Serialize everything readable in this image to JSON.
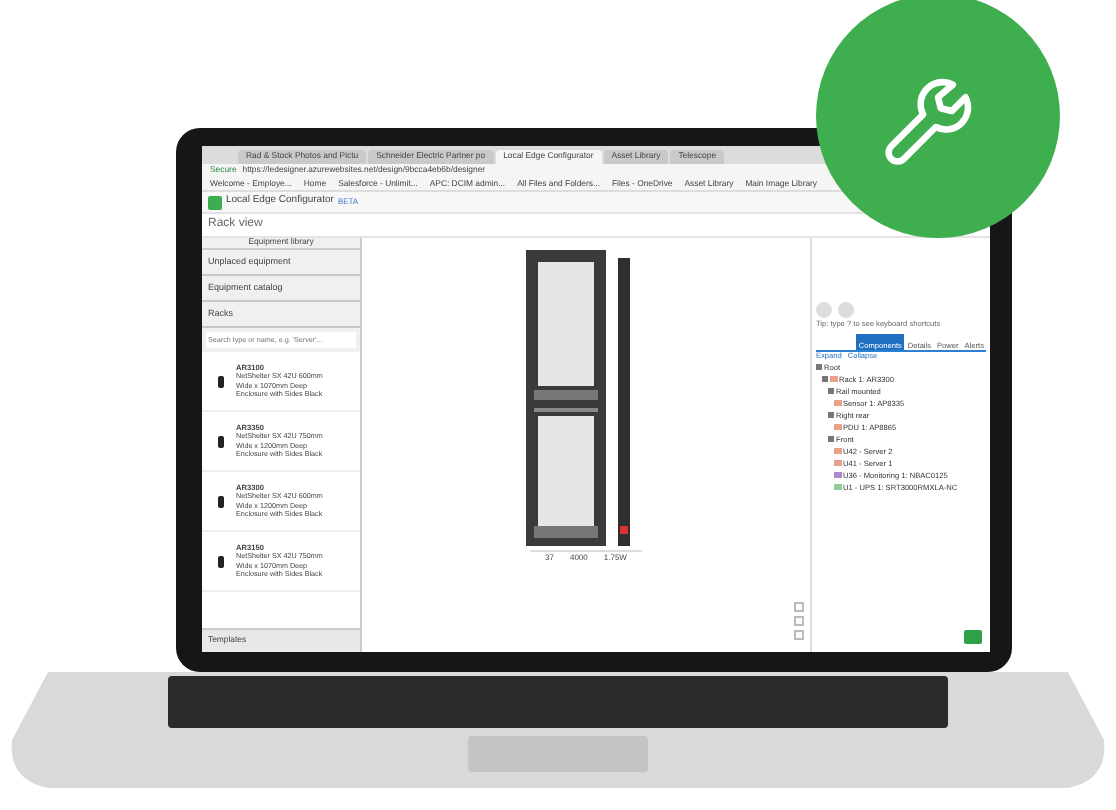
{
  "browser": {
    "tabs": [
      {
        "label": "Rad & Stock Photos and Pictu",
        "selected": false
      },
      {
        "label": "Schneider Electric Partner po",
        "selected": false
      },
      {
        "label": "Local Edge Configurator",
        "selected": true
      },
      {
        "label": "Asset Library",
        "selected": false
      },
      {
        "label": "Telescope",
        "selected": false
      }
    ],
    "secure": "Secure",
    "url": "https://ledesigner.azurewebsites.net/design/9bcca4eb6b/designer",
    "bookmarks": [
      "Welcome - Employe...",
      "Home",
      "Salesforce - Unlimit...",
      "APC: DCIM admin...",
      "All Files and Folders...",
      "Files - OneDrive",
      "Asset Library",
      "Main Image Library"
    ]
  },
  "app": {
    "title": "Local Edge Configurator",
    "badge": "BETA",
    "view_title": "Rack view"
  },
  "library": {
    "title": "Equipment library",
    "sections": [
      "Unplaced equipment",
      "Equipment catalog",
      "Racks"
    ],
    "search": {
      "placeholder": "Search type or name, e.g. 'Server'..."
    },
    "items": [
      {
        "code": "AR3100",
        "description": "NetShelter SX 42U 600mm Wide x 1070mm Deep Enclosure with Sides Black"
      },
      {
        "code": "AR3350",
        "description": "NetShelter SX 42U 750mm Wide x 1200mm Deep Enclosure with Sides Black"
      },
      {
        "code": "AR3300",
        "description": "NetShelter SX 42U 600mm Wide x 1200mm Deep Enclosure with Sides Black"
      },
      {
        "code": "AR3150",
        "description": "NetShelter SX 42U 750mm Wide x 1070mm Deep Enclosure with Sides Black"
      }
    ],
    "footer": "Templates"
  },
  "canvas": {
    "readings": [
      "37",
      "4000",
      "1.75W"
    ]
  },
  "panel": {
    "tip": "Tip: type ? to see keyboard shortcuts",
    "tabs": [
      {
        "label": "Components",
        "selected": true
      },
      {
        "label": "Details",
        "selected": false
      },
      {
        "label": "Power",
        "selected": false
      },
      {
        "label": "Alerts",
        "selected": false
      }
    ],
    "links": [
      "Expand",
      "Collapse"
    ],
    "tree": [
      {
        "label": "Root",
        "expanded": true,
        "children": [
          {
            "label": "Rack 1: AR3300",
            "expanded": true,
            "color": "#e8a08a",
            "children": [
              {
                "label": "Rail mounted",
                "expanded": true,
                "children": [
                  {
                    "label": "Sensor 1: AP8335",
                    "color": "#e8a08a"
                  }
                ]
              },
              {
                "label": "Right rear",
                "expanded": true,
                "children": [
                  {
                    "label": "PDU 1: AP8865",
                    "color": "#e8a08a"
                  }
                ]
              },
              {
                "label": "Front",
                "expanded": true,
                "children": [
                  {
                    "label": "U42 - Server 2",
                    "color": "#e8a08a"
                  },
                  {
                    "label": "U41 - Server 1",
                    "color": "#e8a08a"
                  },
                  {
                    "label": "U36 - Monitoring 1: NBAC0125",
                    "color": "#a98bc9"
                  },
                  {
                    "label": "U1 - UPS 1: SRT3000RMXLA-NC",
                    "color": "#8fce9a"
                  }
                ]
              }
            ]
          }
        ]
      }
    ]
  }
}
